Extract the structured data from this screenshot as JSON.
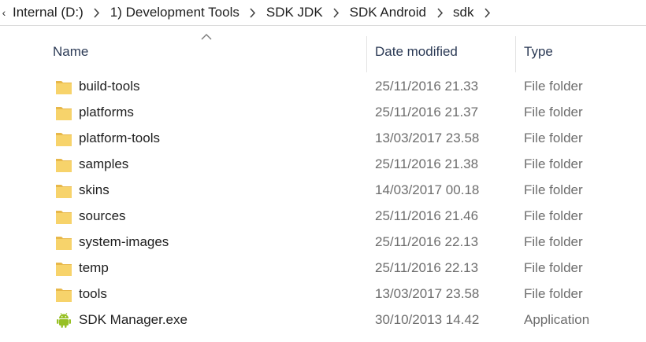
{
  "breadcrumb": [
    "Internal (D:)",
    "1) Development Tools",
    "SDK JDK",
    "SDK Android",
    "sdk"
  ],
  "columns": {
    "name": "Name",
    "date": "Date modified",
    "type": "Type"
  },
  "colors": {
    "folder": "#f7d36b",
    "android": "#97c024",
    "header_text": "#2b3a55",
    "secondary_text": "#6d6d6d"
  },
  "files": [
    {
      "name": "build-tools",
      "date": "25/11/2016 21.33",
      "type": "File folder",
      "icon": "folder-icon"
    },
    {
      "name": "platforms",
      "date": "25/11/2016 21.37",
      "type": "File folder",
      "icon": "folder-icon"
    },
    {
      "name": "platform-tools",
      "date": "13/03/2017 23.58",
      "type": "File folder",
      "icon": "folder-icon"
    },
    {
      "name": "samples",
      "date": "25/11/2016 21.38",
      "type": "File folder",
      "icon": "folder-icon"
    },
    {
      "name": "skins",
      "date": "14/03/2017 00.18",
      "type": "File folder",
      "icon": "folder-icon"
    },
    {
      "name": "sources",
      "date": "25/11/2016 21.46",
      "type": "File folder",
      "icon": "folder-icon"
    },
    {
      "name": "system-images",
      "date": "25/11/2016 22.13",
      "type": "File folder",
      "icon": "folder-icon"
    },
    {
      "name": "temp",
      "date": "25/11/2016 22.13",
      "type": "File folder",
      "icon": "folder-icon"
    },
    {
      "name": "tools",
      "date": "13/03/2017 23.58",
      "type": "File folder",
      "icon": "folder-icon"
    },
    {
      "name": "SDK Manager.exe",
      "date": "30/10/2013 14.42",
      "type": "Application",
      "icon": "android-icon"
    }
  ]
}
